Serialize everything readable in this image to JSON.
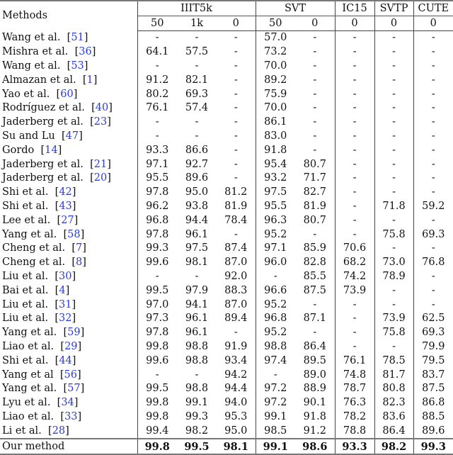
{
  "header": {
    "methods_label": "Methods",
    "groups": [
      {
        "label": "IIIT5k",
        "subcols": [
          "50",
          "1k",
          "0"
        ]
      },
      {
        "label": "SVT",
        "subcols": [
          "50",
          "0"
        ]
      },
      {
        "label": "IC15",
        "subcols": [
          "0"
        ]
      },
      {
        "label": "SVTP",
        "subcols": [
          "0"
        ]
      },
      {
        "label": "CUTE",
        "subcols": [
          "0"
        ]
      }
    ]
  },
  "rows": [
    {
      "method": "Wang et al.",
      "cite": "51",
      "values": [
        "-",
        "-",
        "-",
        "57.0",
        "-",
        "-",
        "-",
        "-"
      ]
    },
    {
      "method": "Mishra et al.",
      "cite": "36",
      "values": [
        "64.1",
        "57.5",
        "-",
        "73.2",
        "-",
        "-",
        "-",
        "-"
      ]
    },
    {
      "method": "Wang et al.",
      "cite": "53",
      "values": [
        "-",
        "-",
        "-",
        "70.0",
        "-",
        "-",
        "-",
        "-"
      ]
    },
    {
      "method": "Almazan et al.",
      "cite": "1",
      "values": [
        "91.2",
        "82.1",
        "-",
        "89.2",
        "-",
        "-",
        "-",
        "-"
      ]
    },
    {
      "method": "Yao et al.",
      "cite": "60",
      "values": [
        "80.2",
        "69.3",
        "-",
        "75.9",
        "-",
        "-",
        "-",
        "-"
      ]
    },
    {
      "method": "Rodríguez et al.",
      "cite": "40",
      "values": [
        "76.1",
        "57.4",
        "-",
        "70.0",
        "-",
        "-",
        "-",
        "-"
      ]
    },
    {
      "method": "Jaderberg et al.",
      "cite": "23",
      "values": [
        "-",
        "-",
        "-",
        "86.1",
        "-",
        "-",
        "-",
        "-"
      ]
    },
    {
      "method": "Su and Lu",
      "cite": "47",
      "values": [
        "-",
        "-",
        "-",
        "83.0",
        "-",
        "-",
        "-",
        "-"
      ]
    },
    {
      "method": "Gordo",
      "cite": "14",
      "values": [
        "93.3",
        "86.6",
        "-",
        "91.8",
        "-",
        "-",
        "-",
        "-"
      ]
    },
    {
      "method": "Jaderberg et al.",
      "cite": "21",
      "values": [
        "97.1",
        "92.7",
        "-",
        "95.4",
        "80.7",
        "-",
        "-",
        "-"
      ]
    },
    {
      "method": "Jaderberg et al.",
      "cite": "20",
      "values": [
        "95.5",
        "89.6",
        "-",
        "93.2",
        "71.7",
        "-",
        "-",
        "-"
      ]
    },
    {
      "method": "Shi et al.",
      "cite": "42",
      "values": [
        "97.8",
        "95.0",
        "81.2",
        "97.5",
        "82.7",
        "-",
        "-",
        "-"
      ]
    },
    {
      "method": "Shi et al.",
      "cite": "43",
      "values": [
        "96.2",
        "93.8",
        "81.9",
        "95.5",
        "81.9",
        "-",
        "71.8",
        "59.2"
      ]
    },
    {
      "method": "Lee et al.",
      "cite": "27",
      "values": [
        "96.8",
        "94.4",
        "78.4",
        "96.3",
        "80.7",
        "-",
        "-",
        "-"
      ]
    },
    {
      "method": "Yang et al.",
      "cite": "58",
      "values": [
        "97.8",
        "96.1",
        "-",
        "95.2",
        "-",
        "-",
        "75.8",
        "69.3"
      ]
    },
    {
      "method": "Cheng et al.",
      "cite": "7",
      "values": [
        "99.3",
        "97.5",
        "87.4",
        "97.1",
        "85.9",
        "70.6",
        "-",
        "-"
      ]
    },
    {
      "method": "Cheng et al.",
      "cite": "8",
      "values": [
        "99.6",
        "98.1",
        "87.0",
        "96.0",
        "82.8",
        "68.2",
        "73.0",
        "76.8"
      ]
    },
    {
      "method": "Liu et al.",
      "cite": "30",
      "values": [
        "-",
        "-",
        "92.0",
        "-",
        "85.5",
        "74.2",
        "78.9",
        "-"
      ]
    },
    {
      "method": "Bai et al.",
      "cite": "4",
      "values": [
        "99.5",
        "97.9",
        "88.3",
        "96.6",
        "87.5",
        "73.9",
        "-",
        "-"
      ]
    },
    {
      "method": "Liu et al.",
      "cite": "31",
      "values": [
        "97.0",
        "94.1",
        "87.0",
        "95.2",
        "-",
        "-",
        "-",
        "-"
      ]
    },
    {
      "method": "Liu et al.",
      "cite": "32",
      "values": [
        "97.3",
        "96.1",
        "89.4",
        "96.8",
        "87.1",
        "-",
        "73.9",
        "62.5"
      ]
    },
    {
      "method": "Yang et al.",
      "cite": "59",
      "values": [
        "97.8",
        "96.1",
        "-",
        "95.2",
        "-",
        "-",
        "75.8",
        "69.3"
      ]
    },
    {
      "method": "Liao et al.",
      "cite": "29",
      "values": [
        "99.8",
        "98.8",
        "91.9",
        "98.8",
        "86.4",
        "-",
        "-",
        "79.9"
      ]
    },
    {
      "method": "Shi et al.",
      "cite": "44",
      "values": [
        "99.6",
        "98.8",
        "93.4",
        "97.4",
        "89.5",
        "76.1",
        "78.5",
        "79.5"
      ]
    },
    {
      "method": "Yang et al",
      "cite": "56",
      "values": [
        "-",
        "-",
        "94.2",
        "-",
        "89.0",
        "74.8",
        "81.7",
        "83.7"
      ]
    },
    {
      "method": "Yang et al.",
      "cite": "57",
      "values": [
        "99.5",
        "98.8",
        "94.4",
        "97.2",
        "88.9",
        "78.7",
        "80.8",
        "87.5"
      ]
    },
    {
      "method": "Lyu et al.",
      "cite": "34",
      "values": [
        "99.8",
        "99.1",
        "94.0",
        "97.2",
        "90.1",
        "76.3",
        "82.3",
        "86.8"
      ]
    },
    {
      "method": "Liao et al.",
      "cite": "33",
      "values": [
        "99.8",
        "99.3",
        "95.3",
        "99.1",
        "91.8",
        "78.2",
        "83.6",
        "88.5"
      ]
    },
    {
      "method": "Li et al.",
      "cite": "28",
      "values": [
        "99.4",
        "98.2",
        "95.0",
        "98.5",
        "91.2",
        "78.8",
        "86.4",
        "89.6"
      ]
    }
  ],
  "ours": {
    "method": "Our method",
    "values": [
      "99.8",
      "99.5",
      "98.1",
      "99.1",
      "98.6",
      "93.3",
      "98.2",
      "99.3"
    ]
  },
  "colors": {
    "citation": "#2b3be0",
    "rule": "#777777"
  }
}
